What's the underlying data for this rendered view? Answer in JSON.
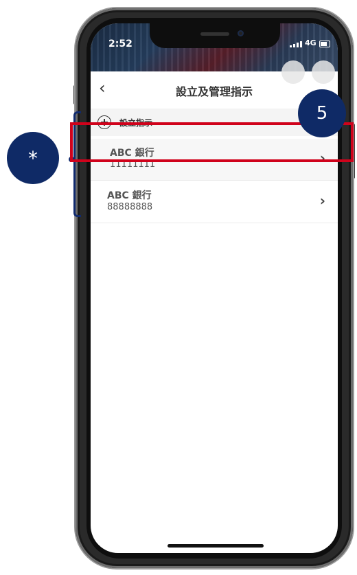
{
  "status_bar": {
    "time": "2:52",
    "network": "4G"
  },
  "header": {
    "title": "設立及管理指示",
    "back_icon": "‹"
  },
  "add_row": {
    "label": "設立指示"
  },
  "list": {
    "items": [
      {
        "bank": "ABC 銀行",
        "account": "11111111",
        "chevron": "›"
      },
      {
        "bank": "ABC 銀行",
        "account": "88888888",
        "chevron": "›"
      }
    ]
  },
  "annotations": {
    "step_badge": "5",
    "star_badge": "*"
  },
  "colors": {
    "badge": "#0f2a66",
    "highlight": "#d0021b"
  }
}
